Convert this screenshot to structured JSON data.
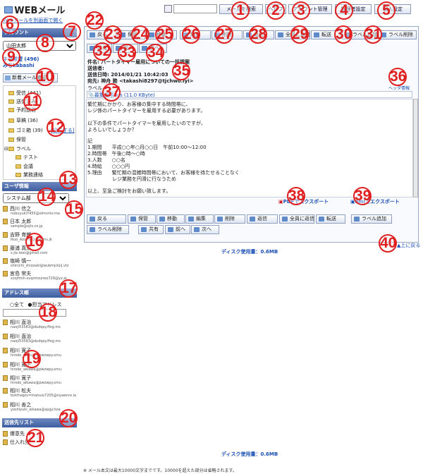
{
  "header": {
    "logo": "WEBメール",
    "open_new_window": "Webメールを別画面で開く",
    "search_placeholder": "",
    "search_btn": "メールを検索",
    "help_btn": "ヘルプ",
    "account_mgmt_btn": "アカウント管理",
    "admin_btn": "管理者設定",
    "personal_btn": "個人設定"
  },
  "account": {
    "title": "アカウント",
    "selected": "山田太郎",
    "name_line": "ネマ希望 (496)",
    "sub_line": "みちkabashi",
    "new_mail_btn": "新着メール確認"
  },
  "folders": [
    {
      "label": "受信 (441)"
    },
    {
      "label": "送信済み"
    },
    {
      "label": "予約送信"
    },
    {
      "label": "草稿 (36)"
    },
    {
      "label": "ゴミ箱 (39)"
    },
    {
      "label": "保管"
    },
    {
      "label": "ラベル"
    },
    {
      "label": "テスト"
    },
    {
      "label": "会議"
    },
    {
      "label": "業務連絡"
    }
  ],
  "empty_trash": "[空にする]",
  "user_info": {
    "title": "ユーザ情報",
    "dept": "システム部",
    "users": [
      {
        "name": "西川 信之",
        "email": "nobuyuki7455@xlmvnlo.ma"
      },
      {
        "name": "日本 太郎",
        "email": "sample@xjts.co.jp"
      },
      {
        "name": "吉野 育朗",
        "email": "lkuo_Azuma@nnnzns.jk"
      },
      {
        "name": "藤浦 真未",
        "email": "s.jts.test@gmail.com"
      },
      {
        "name": "塩崎 慎一",
        "email": "shinichi_shiozaki@wubmjckjij.vtz"
      },
      {
        "name": "宮島 常夫",
        "email": "scojfmih-svqmtsuneo729@yz.ai"
      }
    ]
  },
  "address_book": {
    "title": "アドレス帳",
    "opt_all": "全て",
    "opt_tagged": "担当アドレス",
    "entries": [
      {
        "name": "相川 直治",
        "email": "naoji53583@dudqsy.ffog.ms"
      },
      {
        "name": "相川 直治",
        "email": "naoji53583@dudqsy.ffog.ms"
      },
      {
        "name": "相川 寛子",
        "email": "hiroko_aikawa@pwzwpy.smu"
      },
      {
        "name": "相川 寛子",
        "email": "hiroko_aikawa@pwzwpy.smu"
      },
      {
        "name": "相川 寛子",
        "email": "hiroko_aikawa@pwzwpy.smu"
      },
      {
        "name": "相川 松夫",
        "email": "bvkfraqov=matsuo7205@nyawnrx.la"
      },
      {
        "name": "相川 善之",
        "email": "yoshiyuki_aikawa@spgy.hoa"
      }
    ]
  },
  "send_list": {
    "title": "送信先リスト",
    "items": [
      "爆意先",
      "仕入れ先"
    ]
  },
  "toolbar": {
    "back": "戻る",
    "keep": "保管",
    "move": "移動",
    "edit": "編集",
    "delete": "削除",
    "reply": "返信",
    "reply_all": "全員に返信",
    "forward": "転送",
    "add_label": "ラベル追加",
    "remove_label": "ラベル削除",
    "share": "共有",
    "prev": "前へ",
    "next": "次へ"
  },
  "mail": {
    "subject": "件名: パートタイマー雇用についての一括提案",
    "sender": "送信者:",
    "date": "送信日時: 2014/01/21 10:42:03",
    "to": "宛先: 神舟 務 <takashi8297@tjchwo.lyi>",
    "label": "ラベル",
    "header_info": "ヘッダ情報",
    "attachment": "募集要項.xls (11.0 KByte)",
    "body": [
      "繁忙期にかかり、お客様の集中する時間帯に、",
      "レジ係のパートタイマーを雇用する必要があります。",
      "",
      "以下の条件でパートタイマーを雇用したいのですが、",
      "よろしいでしょうか？",
      "",
      "記",
      "1.期間　　平成○○年○月○○日　午前10:00〜12:00",
      "2.時間帯　午後○時〜○時",
      "3.人数　　○○名",
      "4.時給　　○○○円",
      "5.理由　　繁忙期の混雑時間帯において、お客様を待たせることなく",
      "　　　　　レジ業務を円滑に行なうため",
      "",
      "以上、至急ご検討をお願い致します。"
    ]
  },
  "export": {
    "pdf": "PDFでエクスポート",
    "eml": "emlでエクスポート"
  },
  "back_top": "上に戻る",
  "disk_usage": "ディスク使用量：0.6MB",
  "footer_note": "※ メール本文は最大10000文字までです。10000を超えた部分は省略されます。",
  "badges": [
    "1",
    "2",
    "3",
    "4",
    "5",
    "6",
    "7",
    "8",
    "9",
    "10",
    "11",
    "12",
    "13",
    "14",
    "15",
    "16",
    "17",
    "18",
    "19",
    "20",
    "21",
    "22",
    "23",
    "24",
    "25",
    "26",
    "27",
    "28",
    "29",
    "30",
    "31",
    "32",
    "33",
    "34",
    "35",
    "36",
    "37",
    "38",
    "39",
    "40"
  ],
  "colors": {
    "accent": "#3d5ea0",
    "badge": "#e02020",
    "link": "#1a4fb5"
  }
}
